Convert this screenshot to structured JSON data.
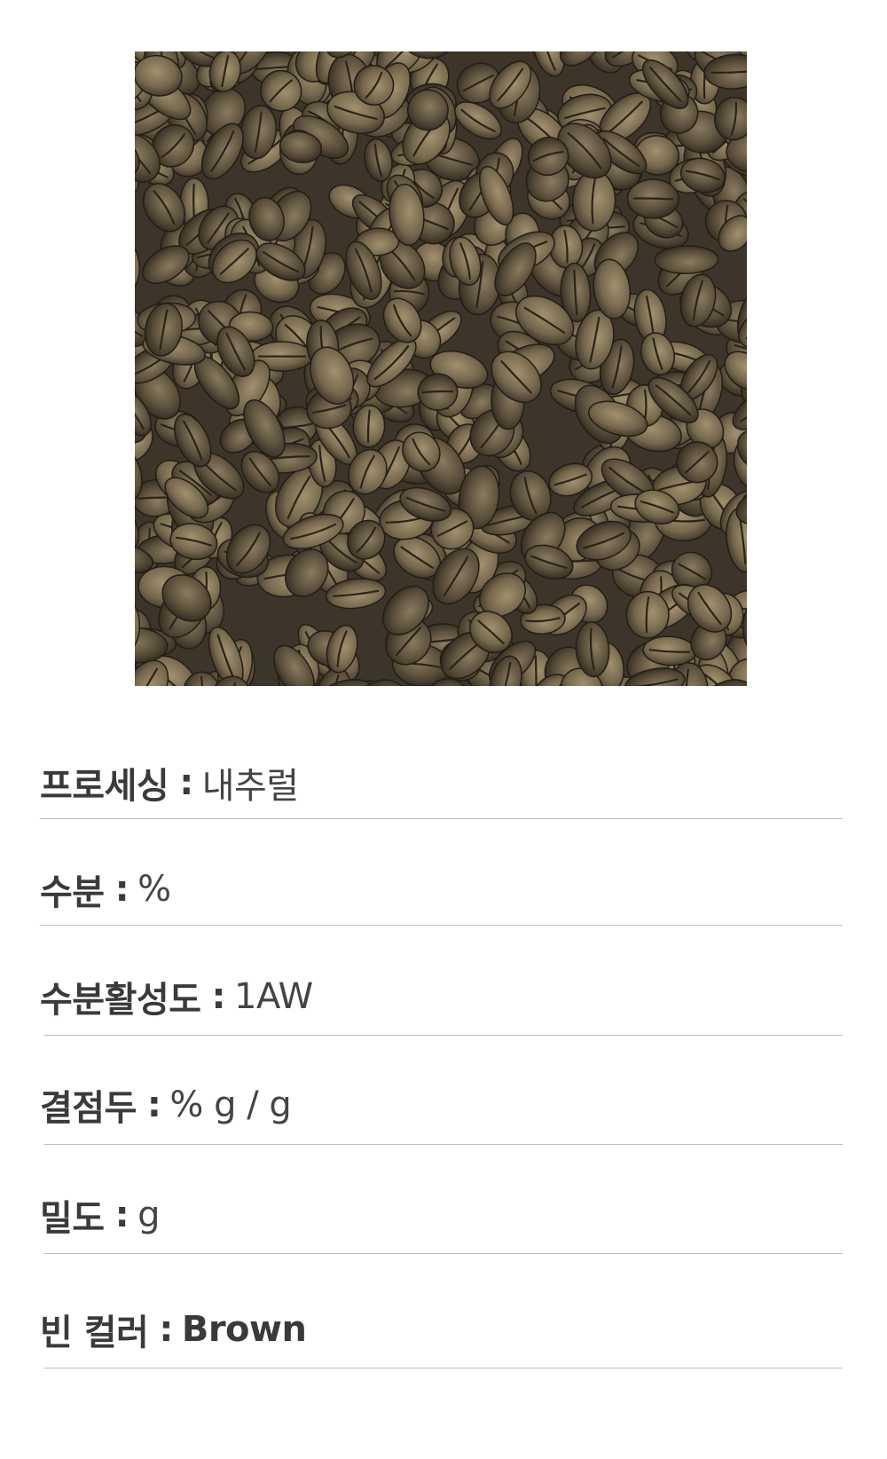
{
  "product_image": {
    "alt": "coffee-beans-photo"
  },
  "specs": [
    {
      "label": "프로세싱",
      "separator": ":",
      "value": "내추럴"
    },
    {
      "label": "수분",
      "separator": ":",
      "value": "%"
    },
    {
      "label": "수분활성도",
      "separator": ":",
      "value": "1AW"
    },
    {
      "label": "결점두",
      "separator": ":",
      "value": "% g / g"
    },
    {
      "label": "밀도",
      "separator": ":",
      "value": "g"
    },
    {
      "label": "빈 컬러",
      "separator": ":",
      "value": "Brown"
    }
  ]
}
